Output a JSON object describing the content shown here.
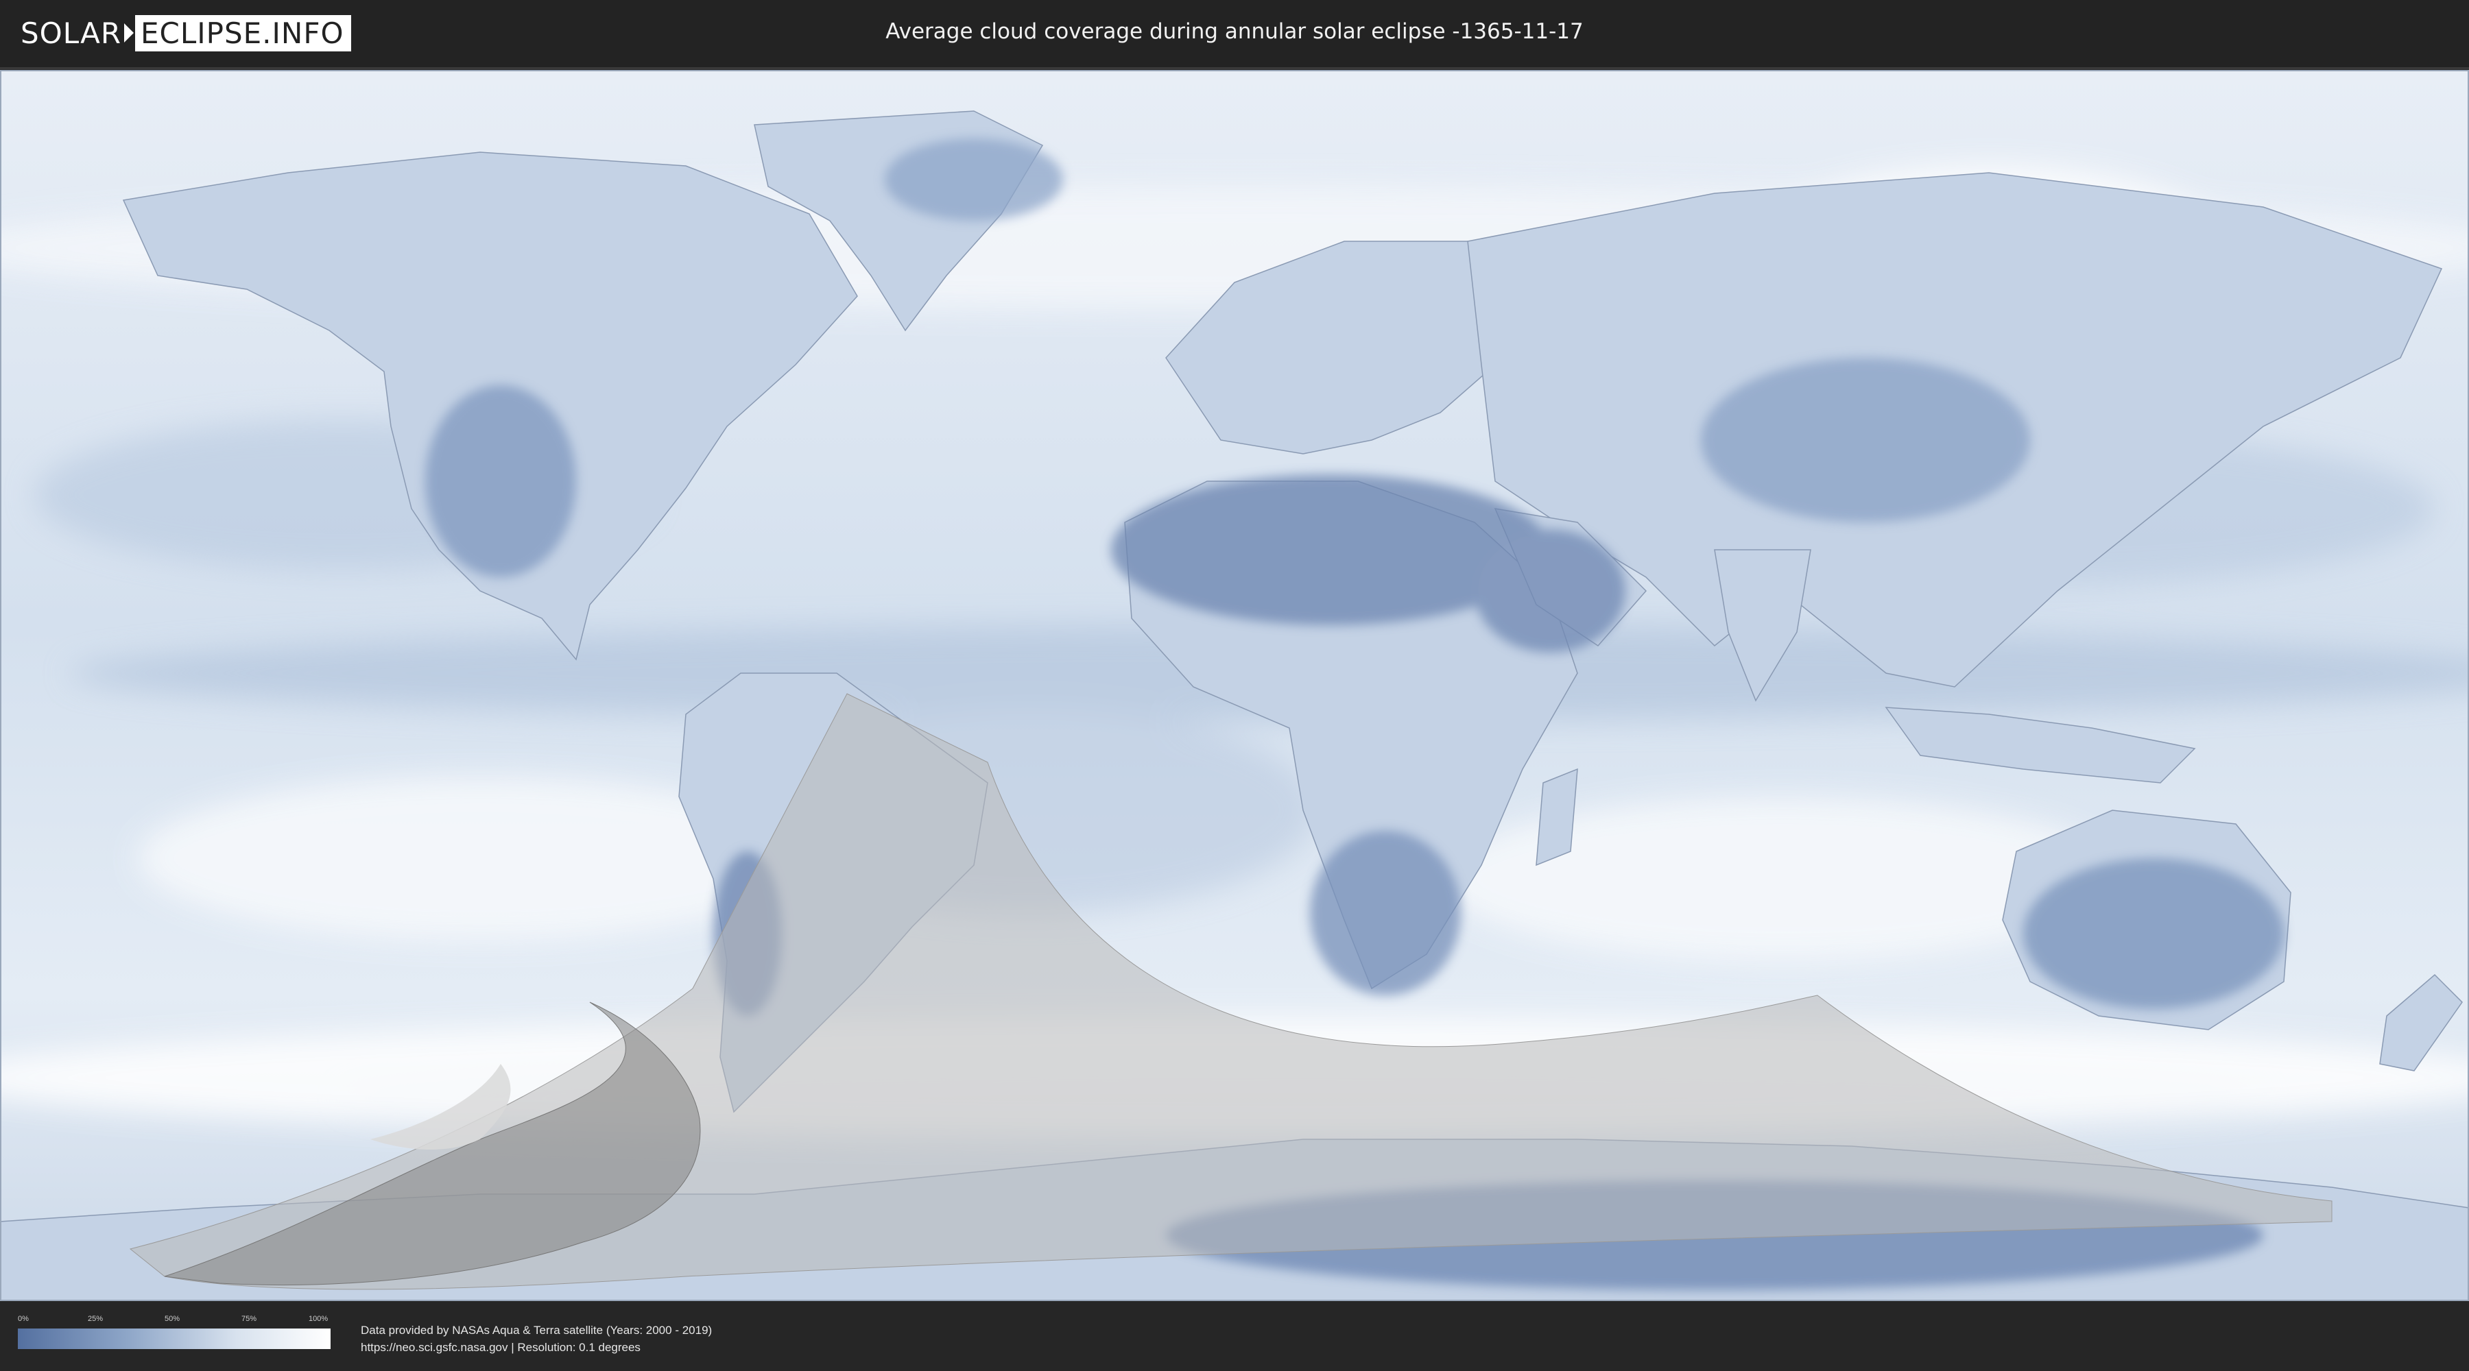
{
  "header": {
    "logo_part1": "SOLAR",
    "logo_part2": "ECLIPSE.INFO",
    "title": "Average cloud coverage during annular solar eclipse -1365-11-17"
  },
  "map": {
    "ocean_color": "#dbe6f1",
    "cloud_color": "#ffffff",
    "land_clear_color": "#6f88b4",
    "eclipse_zone_color": "#bdbdbd",
    "annular_path_color": "#8c8c8c"
  },
  "legend": {
    "ticks": [
      "0%",
      "25%",
      "50%",
      "75%",
      "100%"
    ],
    "gradient_colors": [
      "#5470a0",
      "#8ea6c8",
      "#d8e2ee",
      "#ffffff"
    ]
  },
  "footer": {
    "line1": "Data provided by NASAs Aqua & Terra satellite (Years: 2000 - 2019)",
    "line2": "https://neo.sci.gsfc.nasa.gov | Resolution: 0.1 degrees"
  }
}
